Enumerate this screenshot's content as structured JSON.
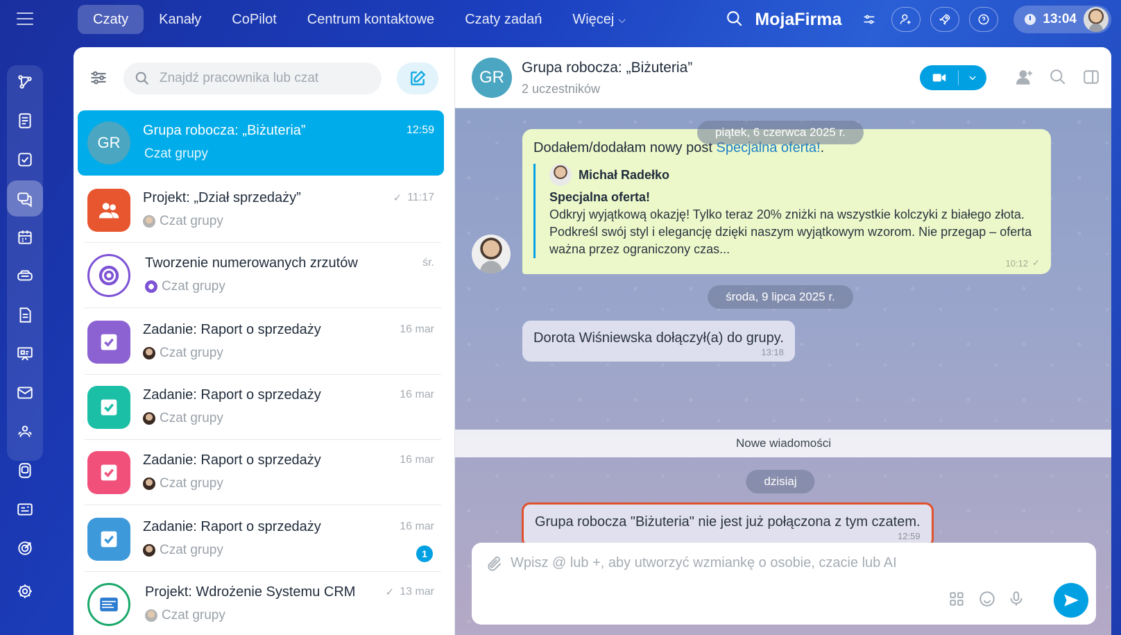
{
  "top_nav": {
    "tabs": [
      "Czaty",
      "Kanały",
      "CoPilot",
      "Centrum kontaktowe",
      "Czaty zadań",
      "Więcej"
    ],
    "active_tab": "Czaty",
    "brand": "MojaFirma",
    "clock": "13:04"
  },
  "sidebar": {
    "icons": [
      "flow-icon",
      "feed-icon",
      "tasks-icon",
      "chat-icon",
      "calendar-icon",
      "crm-icon",
      "documents-icon",
      "board-icon",
      "mail-icon",
      "employees-icon",
      "apps-icon",
      "cards-icon",
      "goals-icon",
      "settings-icon"
    ],
    "active": "chat-icon"
  },
  "chat_list": {
    "search_placeholder": "Znajdź pracownika lub czat",
    "items": [
      {
        "title": "Grupa robocza: „Biżuteria”",
        "subtitle": "Czat grupy",
        "time": "12:59",
        "avatar_text": "GR",
        "avatar_color": "#4ba6c1"
      },
      {
        "title": "Projekt: „Dział sprzedaży”",
        "subtitle": "Czat grupy",
        "time": "11:17",
        "avatar_color": "#e8562f"
      },
      {
        "title": "Tworzenie numerowanych zrzutów",
        "subtitle": "Czat grupy",
        "time": "śr.",
        "avatar_color": "#7d52d4"
      },
      {
        "title": "Zadanie: Raport o sprzedaży",
        "subtitle": "Czat grupy",
        "time": "16 mar",
        "avatar_color": "#8c62d2"
      },
      {
        "title": "Zadanie: Raport o sprzedaży",
        "subtitle": "Czat grupy",
        "time": "16 mar",
        "avatar_color": "#1bbfa5"
      },
      {
        "title": "Zadanie: Raport o sprzedaży",
        "subtitle": "Czat grupy",
        "time": "16 mar",
        "avatar_color": "#f0507a"
      },
      {
        "title": "Zadanie: Raport o sprzedaży",
        "subtitle": "Czat grupy",
        "time": "16 mar",
        "avatar_color": "#3d99d9",
        "badge": "1"
      },
      {
        "title": "Projekt: Wdrożenie Systemu CRM",
        "subtitle": "Czat grupy",
        "time": "13 mar",
        "avatar_color": "#1aa86b"
      }
    ]
  },
  "conversation": {
    "avatar_text": "GR",
    "title": "Grupa robocza: „Biżuteria”",
    "subtitle": "2 uczestników",
    "date1": "piątek, 6 czerwca 2025 r.",
    "post": {
      "prefix": "Dodałem/dodałam nowy post ",
      "link": "Specjalna oferta!",
      "suffix": ".",
      "author": "Michał Radełko",
      "title": "Specjalna oferta!",
      "text": "Odkryj wyjątkową okazję! Tylko teraz 20% zniżki na wszystkie kolczyki z białego złota. Podkreśl swój styl i elegancję dzięki naszym wyjątkowym wzorom. Nie przegap – oferta ważna przez ograniczony czas...",
      "time": "10:12"
    },
    "date2": "środa, 9 lipca 2025 r.",
    "joined": {
      "text": "Dorota Wiśniewska dołączył(a) do grupy.",
      "time": "13:18"
    },
    "new_messages": "Nowe wiadomości",
    "date3": "dzisiaj",
    "disconnected": {
      "text": "Grupa robocza \"Biżuteria\" nie jest już połączona z tym czatem.",
      "time": "12:59"
    },
    "composer_placeholder": "Wpisz @ lub +, aby utworzyć wzmiankę o osobie, czacie lub AI"
  }
}
